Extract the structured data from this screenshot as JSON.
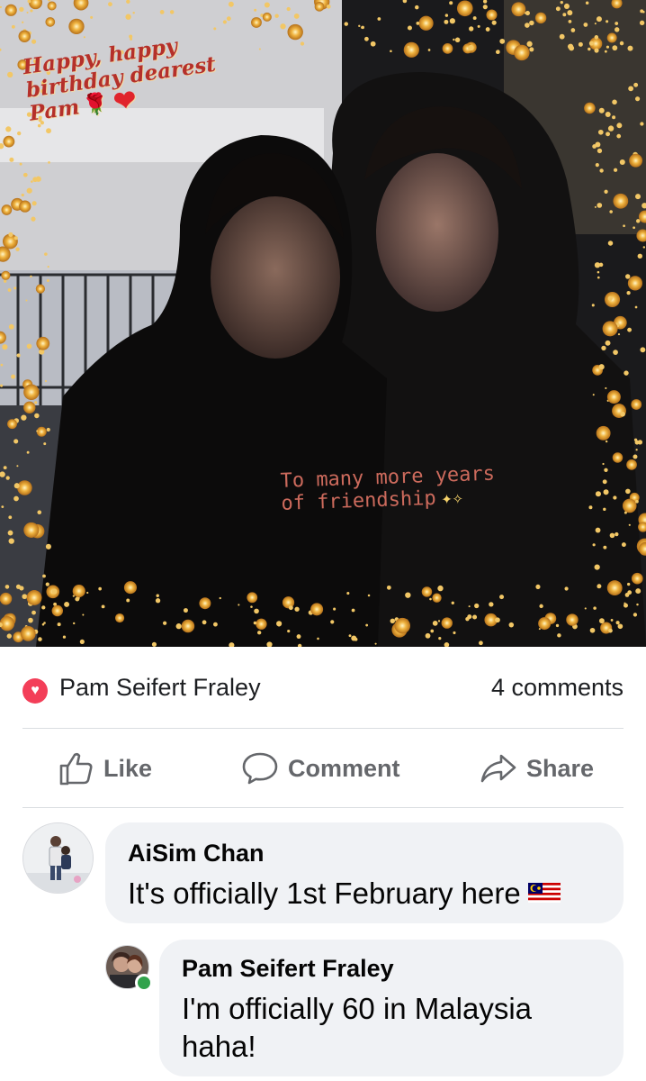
{
  "photo": {
    "greeting_lines": [
      "Happy, happy",
      "birthday dearest",
      "Pam"
    ],
    "greeting_icons": [
      "rose-icon",
      "heart-icon"
    ],
    "caption_lines": [
      "To many more years",
      "of friendship"
    ],
    "caption_icon": "sparkles-icon"
  },
  "reactions": {
    "reaction_icon": "love-reaction-icon",
    "reactor_name": "Pam Seifert Fraley",
    "comments_count": "4 comments"
  },
  "actions": {
    "like_label": "Like",
    "comment_label": "Comment",
    "share_label": "Share"
  },
  "comments": [
    {
      "author": "AiSim Chan",
      "text": "It's officially 1st February here",
      "flag": "malaysia-flag-icon"
    },
    {
      "author": "Pam Seifert Fraley",
      "text_lines": [
        "I'm officially 60 in Malaysia",
        "haha!"
      ],
      "online": true
    }
  ],
  "colors": {
    "love": "#f33e58",
    "action_grey": "#65676b",
    "bubble": "#f0f2f5",
    "online": "#31a24c"
  }
}
